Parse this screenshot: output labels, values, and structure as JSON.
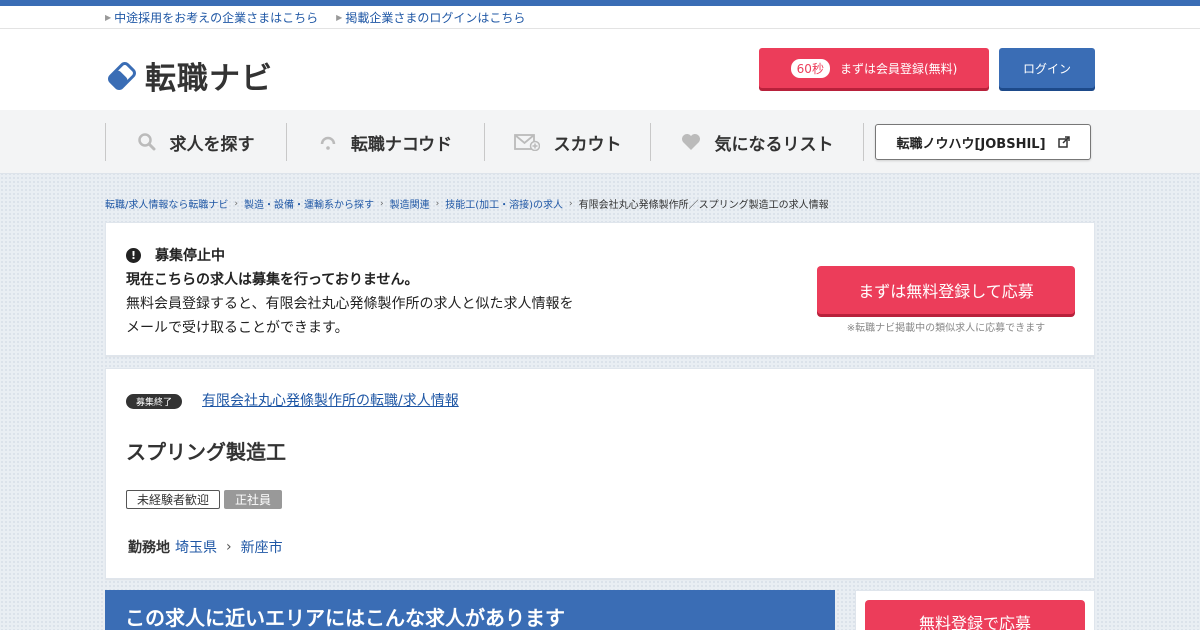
{
  "top_links": [
    "中途採用をお考えの企業さまはこちら",
    "掲載企業さまのログインはこちら"
  ],
  "logo": {
    "text": "転職ナビ",
    "icon": "diamond-logo-icon"
  },
  "header": {
    "register_badge": "60秒",
    "register_label": "まずは会員登録(無料)",
    "login_label": "ログイン"
  },
  "nav": {
    "items": [
      {
        "label": "求人を探す",
        "icon": "search-icon"
      },
      {
        "label": "転職ナコウド",
        "icon": "headset-icon"
      },
      {
        "label": "スカウト",
        "icon": "mail-plus-icon"
      },
      {
        "label": "気になるリスト",
        "icon": "heart-icon"
      }
    ],
    "jobshil_label": "転職ノウハウ[JOBSHIL]",
    "jobshil_icon": "external-link-icon"
  },
  "breadcrumb": [
    "転職/求人情報なら転職ナビ",
    "製造・設備・運輸系から探す",
    "製造関連",
    "技能工(加工・溶接)の求人",
    "有限会社丸心発條製作所／スプリング製造工の求人情報"
  ],
  "notice": {
    "heading": "募集停止中",
    "line1": "現在こちらの求人は募集を行っておりません。",
    "line2": "無料会員登録すると、有限会社丸心発條製作所の求人と似た求人情報を",
    "line3": "メールで受け取ることができます。",
    "apply_button": "まずは無料登録して応募",
    "apply_note": "※転職ナビ掲載中の類似求人に応募できます"
  },
  "job": {
    "status_badge": "募集終了",
    "company_link": "有限会社丸心発條製作所の転職/求人情報",
    "title": "スプリング製造工",
    "tags": [
      "未経験者歓迎",
      "正社員"
    ],
    "location_label": "勤務地",
    "prefecture": "埼玉県",
    "city": "新座市"
  },
  "nearby": {
    "heading": "この求人に近いエリアにはこんな求人があります",
    "side_button": "無料登録で応募"
  },
  "colors": {
    "brand_blue": "#3a6db5",
    "accent_pink": "#ec3d5a",
    "link_blue": "#1f57a5"
  }
}
